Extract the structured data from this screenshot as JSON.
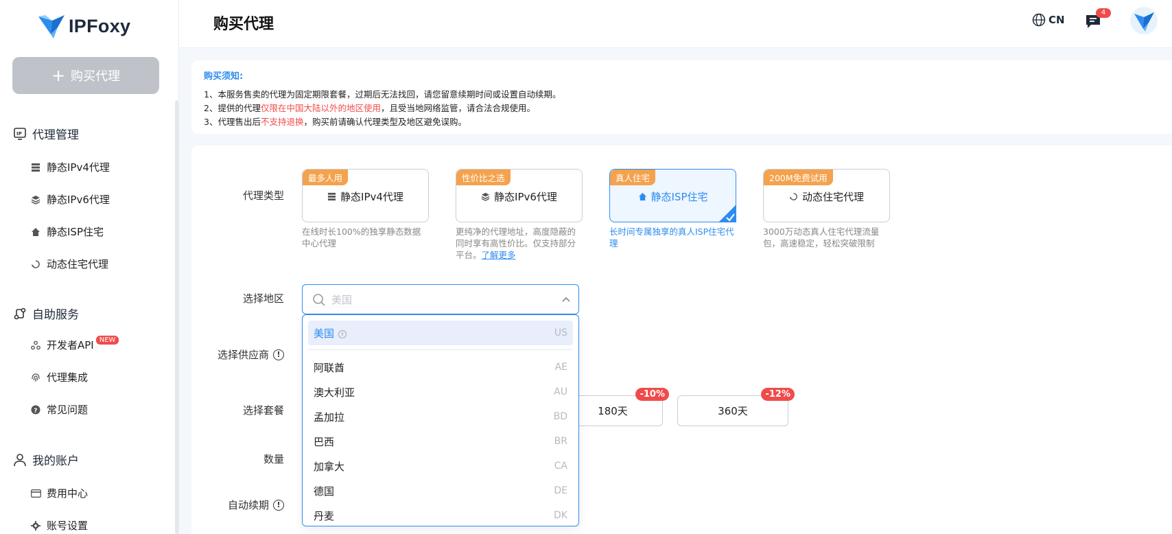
{
  "brand": {
    "name": "IPFoxy"
  },
  "sidebar": {
    "buy_button": "购买代理",
    "groups": [
      {
        "label": "代理管理",
        "icon": "ip-icon"
      },
      {
        "label": "自助服务",
        "icon": "service-icon"
      },
      {
        "label": "我的账户",
        "icon": "user-icon"
      }
    ],
    "items": [
      {
        "label": "静态IPv4代理",
        "icon": "server-icon"
      },
      {
        "label": "静态IPv6代理",
        "icon": "layers-icon"
      },
      {
        "label": "静态ISP住宅",
        "icon": "home-icon"
      },
      {
        "label": "动态住宅代理",
        "icon": "refresh-icon"
      },
      {
        "label": "开发者API",
        "icon": "webhook-icon",
        "badge": "NEW"
      },
      {
        "label": "代理集成",
        "icon": "fingerprint-icon"
      },
      {
        "label": "常见问题",
        "icon": "question-icon"
      },
      {
        "label": "费用中心",
        "icon": "card-icon"
      },
      {
        "label": "账号设置",
        "icon": "gear-icon"
      }
    ]
  },
  "header": {
    "title": "购买代理",
    "language": "CN",
    "message_count": "4"
  },
  "notice": {
    "title": "购买须知:",
    "line1": "1、本服务售卖的代理为固定期限套餐，过期后无法找回，请您留意续期时间或设置自动续期。",
    "line2_pre": "2、提供的代理",
    "line2_red": "仅限在中国大陆以外的地区使用",
    "line2_post": "，且受当地网络监管，请合法合规使用。",
    "line3_pre": "3、代理售出后",
    "line3_red": "不支持退换",
    "line3_post": "，购买前请确认代理类型及地区避免误购。"
  },
  "form": {
    "labels": {
      "proxy_type": "代理类型",
      "region": "选择地区",
      "provider": "选择供应商",
      "plan": "选择套餐",
      "quantity": "数量",
      "auto_renew": "自动续期"
    },
    "proxy_types": [
      {
        "tag": "最多人用",
        "name": "静态IPv4代理",
        "desc": "在线时长100%的独享静态数据中心代理",
        "selected": false
      },
      {
        "tag": "性价比之选",
        "name": "静态IPv6代理",
        "desc": "更纯净的代理地址，高度隐蔽的同时享有高性价比。仅支持部分平台。",
        "link": "了解更多",
        "selected": false
      },
      {
        "tag": "真人住宅",
        "name": "静态ISP住宅",
        "desc": "长时间专属独享的真人ISP住宅代理",
        "selected": true
      },
      {
        "tag": "200M免费试用",
        "name": "动态住宅代理",
        "desc": "3000万动态真人住宅代理流量包，高速稳定，轻松突破限制",
        "selected": false
      }
    ],
    "region_search": {
      "placeholder": "美国",
      "value": ""
    },
    "plans": [
      {
        "label": "180天",
        "discount": "-10%"
      },
      {
        "label": "360天",
        "discount": "-12%"
      }
    ]
  },
  "region_dropdown": {
    "selected": {
      "name": "美国",
      "code": "US"
    },
    "options": [
      {
        "name": "阿联酋",
        "code": "AE"
      },
      {
        "name": "澳大利亚",
        "code": "AU"
      },
      {
        "name": "孟加拉",
        "code": "BD"
      },
      {
        "name": "巴西",
        "code": "BR"
      },
      {
        "name": "加拿大",
        "code": "CA"
      },
      {
        "name": "德国",
        "code": "DE"
      },
      {
        "name": "丹麦",
        "code": "DK"
      }
    ]
  },
  "colors": {
    "accent": "#2d8cf0",
    "tag": "#f4a24d",
    "danger": "#f04b4b"
  }
}
